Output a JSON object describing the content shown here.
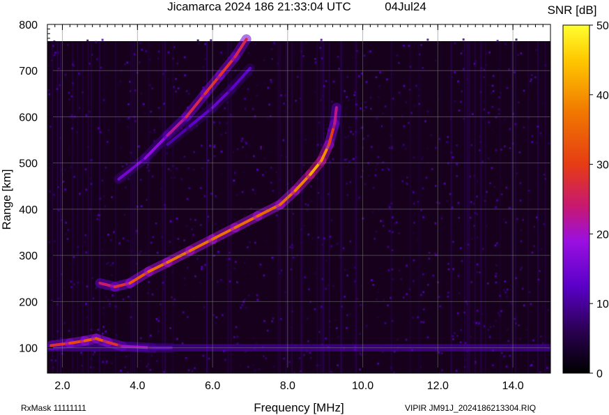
{
  "chart_data": {
    "type": "heatmap",
    "title": "Jicamarca 2024 186 21:33:04 UTC",
    "date_label": "04Jul24",
    "xlabel": "Frequency [MHz]",
    "ylabel": "Range [km]",
    "xlim": [
      1.6,
      15.0
    ],
    "ylim": [
      45,
      800
    ],
    "x_ticks": [
      2.0,
      4.0,
      6.0,
      8.0,
      10.0,
      12.0,
      14.0
    ],
    "x_tick_labels": [
      "2.0",
      "4.0",
      "6.0",
      "8.0",
      "10.0",
      "12.0",
      "14.0"
    ],
    "y_ticks": [
      100,
      200,
      300,
      400,
      500,
      600,
      700,
      800
    ],
    "y_tick_labels": [
      "100",
      "200",
      "300",
      "400",
      "500",
      "600",
      "700",
      "800"
    ],
    "grid": true,
    "colorbar": {
      "label": "SNR [dB]",
      "range": [
        0,
        50
      ],
      "ticks": [
        0,
        10,
        20,
        30,
        40,
        50
      ],
      "tick_labels": [
        "0",
        "10",
        "20",
        "30",
        "40",
        "50"
      ],
      "colors": [
        "#000000",
        "#2a0050",
        "#5a00c8",
        "#9a10e0",
        "#c81870",
        "#e63c14",
        "#f07800",
        "#ffc800",
        "#ffff30"
      ]
    },
    "traces": [
      {
        "points": [
          [
            1.7,
            105
          ],
          [
            2.2,
            110
          ],
          [
            2.6,
            115
          ],
          [
            2.9,
            120
          ],
          [
            3.2,
            112
          ],
          [
            3.6,
            103
          ],
          [
            4.4,
            100
          ],
          [
            4.9,
            100
          ]
        ],
        "snr": [
          26,
          30,
          33,
          35,
          32,
          24,
          16,
          12
        ]
      },
      {
        "points": [
          [
            3.0,
            240
          ],
          [
            3.4,
            232
          ],
          [
            3.8,
            240
          ],
          [
            4.3,
            265
          ],
          [
            4.8,
            285
          ],
          [
            5.4,
            310
          ],
          [
            6.0,
            335
          ],
          [
            6.6,
            360
          ],
          [
            7.2,
            385
          ],
          [
            7.8,
            410
          ],
          [
            8.2,
            440
          ],
          [
            8.6,
            475
          ],
          [
            8.9,
            505
          ],
          [
            9.1,
            540
          ],
          [
            9.25,
            585
          ],
          [
            9.3,
            620
          ]
        ],
        "snr": [
          25,
          24,
          32,
          35,
          37,
          36,
          37,
          36,
          36,
          35,
          37,
          40,
          45,
          34,
          26,
          20
        ]
      },
      {
        "points": [
          [
            3.5,
            465
          ],
          [
            4.2,
            510
          ],
          [
            4.8,
            560
          ],
          [
            5.3,
            600
          ],
          [
            5.8,
            650
          ],
          [
            6.2,
            690
          ],
          [
            6.6,
            730
          ],
          [
            6.9,
            768
          ]
        ],
        "snr": [
          14,
          16,
          20,
          25,
          28,
          29,
          28,
          25
        ]
      },
      {
        "points": [
          [
            4.8,
            540
          ],
          [
            5.4,
            580
          ],
          [
            6.0,
            620
          ],
          [
            6.5,
            660
          ],
          [
            7.0,
            705
          ]
        ],
        "snr": [
          10,
          12,
          14,
          14,
          12
        ]
      }
    ],
    "footer_left": "RxMask 11111111",
    "footer_right": "VIPIR  JM91J_2024186213304.RIQ"
  }
}
